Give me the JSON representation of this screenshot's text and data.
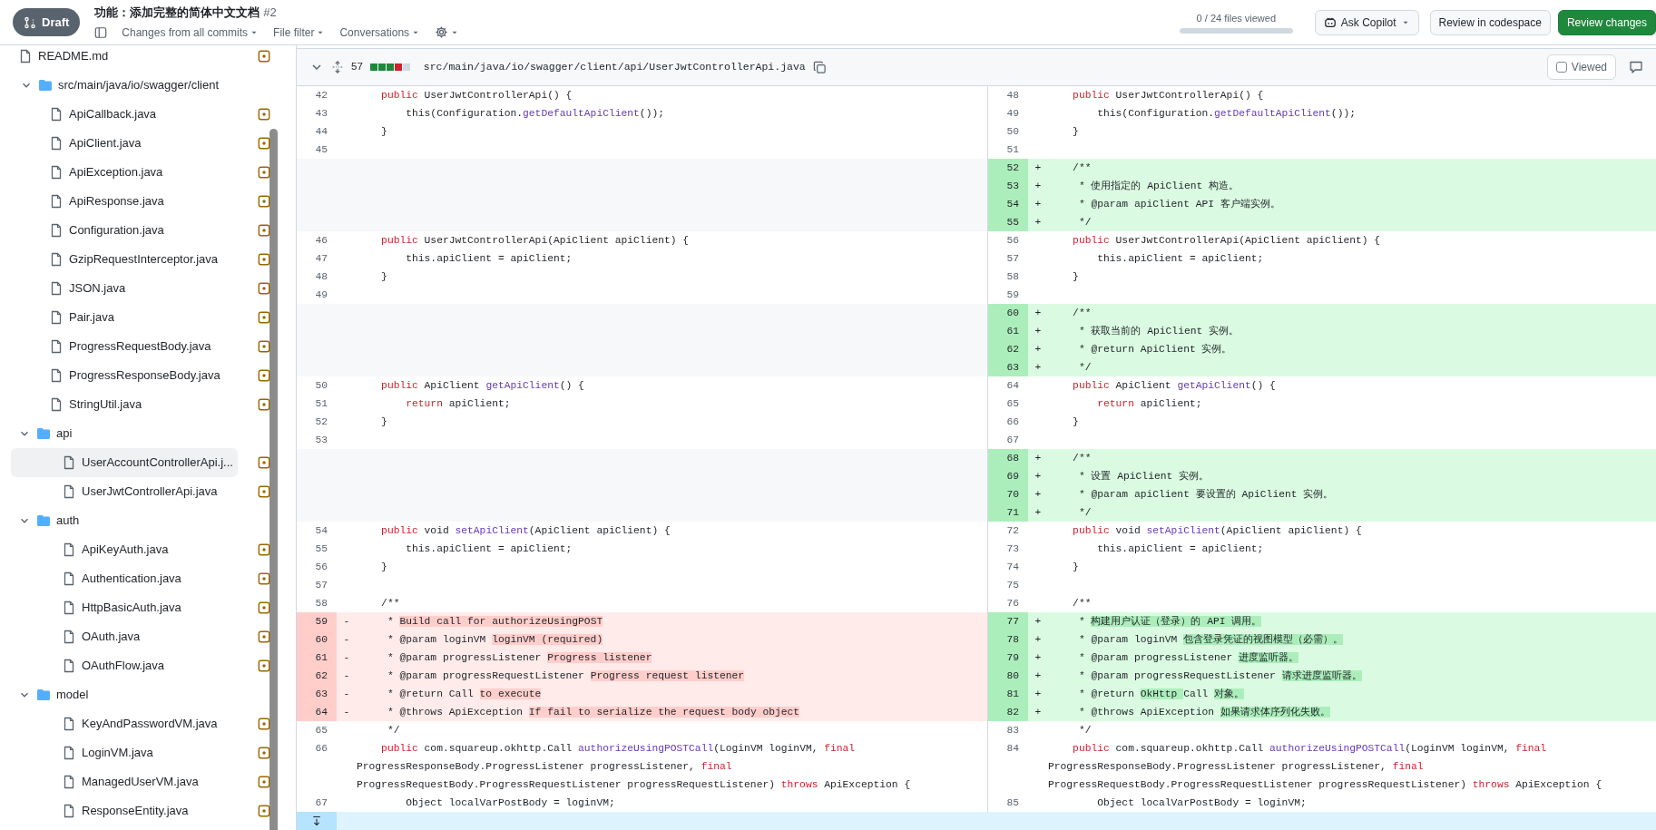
{
  "topbar": {
    "status": "Draft",
    "title": "功能：添加完整的简体中文文档",
    "number": "#2",
    "filters": [
      "Changes from all commits",
      "File filter",
      "Conversations"
    ],
    "viewed_text": "0 / 24 files viewed",
    "viewed_progress": {
      "level": 0
    },
    "buttons": [
      {
        "label": "Ask Copilot",
        "kind": "copilot"
      },
      {
        "label": "Review in codespace",
        "kind": "plain"
      },
      {
        "label": "Review changes",
        "kind": "primary"
      }
    ]
  },
  "tree": {
    "items": [
      {
        "kind": "file",
        "name": "README.md",
        "selected": false
      },
      {
        "kind": "folder",
        "name": "src/main/java/io/swagger/client",
        "expanded": true,
        "selected": false,
        "children": [
          {
            "kind": "file",
            "name": "ApiCallback.java",
            "selected": false
          },
          {
            "kind": "file",
            "name": "ApiClient.java",
            "selected": false
          },
          {
            "kind": "file",
            "name": "ApiException.java",
            "selected": false
          },
          {
            "kind": "file",
            "name": "ApiResponse.java",
            "selected": false
          },
          {
            "kind": "file",
            "name": "Configuration.java",
            "selected": false
          },
          {
            "kind": "file",
            "name": "GzipRequestInterceptor.java",
            "selected": false
          },
          {
            "kind": "file",
            "name": "JSON.java",
            "selected": false
          },
          {
            "kind": "file",
            "name": "Pair.java",
            "selected": false
          },
          {
            "kind": "file",
            "name": "ProgressRequestBody.java",
            "selected": false
          },
          {
            "kind": "file",
            "name": "ProgressResponseBody.java",
            "selected": false
          },
          {
            "kind": "file",
            "name": "StringUtil.java",
            "selected": false
          },
          {
            "kind": "folder",
            "name": "api",
            "expanded": true,
            "selected": false,
            "children": [
              {
                "kind": "file",
                "name": "UserAccountControllerApi.j...",
                "selected": true
              },
              {
                "kind": "file",
                "name": "UserJwtControllerApi.java",
                "selected": false
              }
            ]
          },
          {
            "kind": "folder",
            "name": "auth",
            "expanded": true,
            "selected": false,
            "children": [
              {
                "kind": "file",
                "name": "ApiKeyAuth.java",
                "selected": false
              },
              {
                "kind": "file",
                "name": "Authentication.java",
                "selected": false
              },
              {
                "kind": "file",
                "name": "HttpBasicAuth.java",
                "selected": false
              },
              {
                "kind": "file",
                "name": "OAuth.java",
                "selected": false
              },
              {
                "kind": "file",
                "name": "OAuthFlow.java",
                "selected": false
              }
            ]
          },
          {
            "kind": "folder",
            "name": "model",
            "expanded": true,
            "selected": false,
            "children": [
              {
                "kind": "file",
                "name": "KeyAndPasswordVM.java",
                "selected": false
              },
              {
                "kind": "file",
                "name": "LoginVM.java",
                "selected": false
              },
              {
                "kind": "file",
                "name": "ManagedUserVM.java",
                "selected": false
              },
              {
                "kind": "file",
                "name": "ResponseEntity.java",
                "selected": false
              }
            ]
          }
        ]
      }
    ]
  },
  "file": {
    "expanded": true,
    "changes": "57",
    "diffstat": [
      {
        "kind": "added"
      },
      {
        "kind": "added"
      },
      {
        "kind": "added"
      },
      {
        "kind": "deleted"
      },
      {
        "kind": "neutral"
      }
    ],
    "path": "src/main/java/io/swagger/client/api/UserJwtControllerApi.java",
    "viewed_label": "Viewed",
    "viewed": false
  },
  "rows": [
    {
      "left": {
        "kind": "context",
        "num": "42",
        "lines": [
          [
            {
              "text": "    public",
              "kind": "keyword"
            },
            " UserJwtControllerApi() {"
          ]
        ]
      },
      "right": {
        "kind": "context",
        "num": "48",
        "lines": [
          [
            {
              "text": "    public",
              "kind": "keyword"
            },
            " UserJwtControllerApi() {"
          ]
        ]
      }
    },
    {
      "left": {
        "kind": "context",
        "num": "43",
        "lines": [
          [
            "        this(Configuration.",
            {
              "text": "getDefaultApiClient",
              "kind": "method"
            },
            "());"
          ]
        ]
      },
      "right": {
        "kind": "context",
        "num": "49",
        "lines": [
          [
            "        this(Configuration.",
            {
              "text": "getDefaultApiClient",
              "kind": "method"
            },
            "());"
          ]
        ]
      }
    },
    {
      "left": {
        "kind": "context",
        "num": "44",
        "lines": [
          [
            "    }"
          ]
        ]
      },
      "right": {
        "kind": "context",
        "num": "50",
        "lines": [
          [
            "    }"
          ]
        ]
      }
    },
    {
      "left": {
        "kind": "context",
        "num": "45"
      },
      "right": {
        "kind": "context",
        "num": "51"
      }
    },
    {
      "left": {
        "kind": "empty"
      },
      "right": {
        "kind": "added",
        "num": "52",
        "sign": "+",
        "lines": [
          [
            "    /**"
          ]
        ]
      }
    },
    {
      "left": {
        "kind": "empty"
      },
      "right": {
        "kind": "added",
        "num": "53",
        "sign": "+",
        "lines": [
          [
            "     * 使用指定的 ApiClient 构造。"
          ]
        ]
      }
    },
    {
      "left": {
        "kind": "empty"
      },
      "right": {
        "kind": "added",
        "num": "54",
        "sign": "+",
        "lines": [
          [
            "     * @param apiClient API 客户端实例。"
          ]
        ]
      }
    },
    {
      "left": {
        "kind": "empty"
      },
      "right": {
        "kind": "added",
        "num": "55",
        "sign": "+",
        "lines": [
          [
            "     */"
          ]
        ]
      }
    },
    {
      "left": {
        "kind": "context",
        "num": "46",
        "lines": [
          [
            {
              "text": "    public",
              "kind": "keyword"
            },
            " UserJwtControllerApi(ApiClient apiClient) {"
          ]
        ]
      },
      "right": {
        "kind": "context",
        "num": "56",
        "lines": [
          [
            {
              "text": "    public",
              "kind": "keyword"
            },
            " UserJwtControllerApi(ApiClient apiClient) {"
          ]
        ]
      }
    },
    {
      "left": {
        "kind": "context",
        "num": "47",
        "lines": [
          [
            "        this.apiClient = apiClient;"
          ]
        ]
      },
      "right": {
        "kind": "context",
        "num": "57",
        "lines": [
          [
            "        this.apiClient = apiClient;"
          ]
        ]
      }
    },
    {
      "left": {
        "kind": "context",
        "num": "48",
        "lines": [
          [
            "    }"
          ]
        ]
      },
      "right": {
        "kind": "context",
        "num": "58",
        "lines": [
          [
            "    }"
          ]
        ]
      }
    },
    {
      "left": {
        "kind": "context",
        "num": "49"
      },
      "right": {
        "kind": "context",
        "num": "59"
      }
    },
    {
      "left": {
        "kind": "empty"
      },
      "right": {
        "kind": "added",
        "num": "60",
        "sign": "+",
        "lines": [
          [
            "    /**"
          ]
        ]
      }
    },
    {
      "left": {
        "kind": "empty"
      },
      "right": {
        "kind": "added",
        "num": "61",
        "sign": "+",
        "lines": [
          [
            "     * 获取当前的 ApiClient 实例。"
          ]
        ]
      }
    },
    {
      "left": {
        "kind": "empty"
      },
      "right": {
        "kind": "added",
        "num": "62",
        "sign": "+",
        "lines": [
          [
            "     * @return ApiClient 实例。"
          ]
        ]
      }
    },
    {
      "left": {
        "kind": "empty"
      },
      "right": {
        "kind": "added",
        "num": "63",
        "sign": "+",
        "lines": [
          [
            "     */"
          ]
        ]
      }
    },
    {
      "left": {
        "kind": "context",
        "num": "50",
        "lines": [
          [
            {
              "text": "    public",
              "kind": "keyword"
            },
            " ApiClient ",
            {
              "text": "getApiClient",
              "kind": "method"
            },
            "() {"
          ]
        ]
      },
      "right": {
        "kind": "context",
        "num": "64",
        "lines": [
          [
            {
              "text": "    public",
              "kind": "keyword"
            },
            " ApiClient ",
            {
              "text": "getApiClient",
              "kind": "method"
            },
            "() {"
          ]
        ]
      }
    },
    {
      "left": {
        "kind": "context",
        "num": "51",
        "lines": [
          [
            {
              "text": "        return",
              "kind": "keyword"
            },
            " apiClient;"
          ]
        ]
      },
      "right": {
        "kind": "context",
        "num": "65",
        "lines": [
          [
            {
              "text": "        return",
              "kind": "keyword"
            },
            " apiClient;"
          ]
        ]
      }
    },
    {
      "left": {
        "kind": "context",
        "num": "52",
        "lines": [
          [
            "    }"
          ]
        ]
      },
      "right": {
        "kind": "context",
        "num": "66",
        "lines": [
          [
            "    }"
          ]
        ]
      }
    },
    {
      "left": {
        "kind": "context",
        "num": "53"
      },
      "right": {
        "kind": "context",
        "num": "67"
      }
    },
    {
      "left": {
        "kind": "empty"
      },
      "right": {
        "kind": "added",
        "num": "68",
        "sign": "+",
        "lines": [
          [
            "    /**"
          ]
        ]
      }
    },
    {
      "left": {
        "kind": "empty"
      },
      "right": {
        "kind": "added",
        "num": "69",
        "sign": "+",
        "lines": [
          [
            "     * 设置 ApiClient 实例。"
          ]
        ]
      }
    },
    {
      "left": {
        "kind": "empty"
      },
      "right": {
        "kind": "added",
        "num": "70",
        "sign": "+",
        "lines": [
          [
            "     * @param apiClient 要设置的 ApiClient 实例。"
          ]
        ]
      }
    },
    {
      "left": {
        "kind": "empty"
      },
      "right": {
        "kind": "added",
        "num": "71",
        "sign": "+",
        "lines": [
          [
            "     */"
          ]
        ]
      }
    },
    {
      "left": {
        "kind": "context",
        "num": "54",
        "lines": [
          [
            {
              "text": "    public",
              "kind": "keyword"
            },
            " void ",
            {
              "text": "setApiClient",
              "kind": "method"
            },
            "(ApiClient apiClient) {"
          ]
        ]
      },
      "right": {
        "kind": "context",
        "num": "72",
        "lines": [
          [
            {
              "text": "    public",
              "kind": "keyword"
            },
            " void ",
            {
              "text": "setApiClient",
              "kind": "method"
            },
            "(ApiClient apiClient) {"
          ]
        ]
      }
    },
    {
      "left": {
        "kind": "context",
        "num": "55",
        "lines": [
          [
            "        this.apiClient = apiClient;"
          ]
        ]
      },
      "right": {
        "kind": "context",
        "num": "73",
        "lines": [
          [
            "        this.apiClient = apiClient;"
          ]
        ]
      }
    },
    {
      "left": {
        "kind": "context",
        "num": "56",
        "lines": [
          [
            "    }"
          ]
        ]
      },
      "right": {
        "kind": "context",
        "num": "74",
        "lines": [
          [
            "    }"
          ]
        ]
      }
    },
    {
      "left": {
        "kind": "context",
        "num": "57"
      },
      "right": {
        "kind": "context",
        "num": "75"
      }
    },
    {
      "left": {
        "kind": "context",
        "num": "58",
        "lines": [
          [
            "    /**"
          ]
        ]
      },
      "right": {
        "kind": "context",
        "num": "76",
        "lines": [
          [
            "    /**"
          ]
        ]
      }
    },
    {
      "left": {
        "kind": "deleted",
        "num": "59",
        "sign": "-",
        "lines": [
          [
            "     * ",
            {
              "text": "Build call for authorizeUsingPOST",
              "kind": "changed"
            }
          ]
        ]
      },
      "right": {
        "kind": "added",
        "num": "77",
        "sign": "+",
        "lines": [
          [
            "     * ",
            {
              "text": "构建用户认证（登录）的 API 调用。",
              "kind": "changed"
            }
          ]
        ]
      }
    },
    {
      "left": {
        "kind": "deleted",
        "num": "60",
        "sign": "-",
        "lines": [
          [
            "     * @param loginVM ",
            {
              "text": "loginVM (required)",
              "kind": "changed"
            }
          ]
        ]
      },
      "right": {
        "kind": "added",
        "num": "78",
        "sign": "+",
        "lines": [
          [
            "     * @param loginVM ",
            {
              "text": "包含登录凭证的视图模型（必需）。",
              "kind": "changed"
            }
          ]
        ]
      }
    },
    {
      "left": {
        "kind": "deleted",
        "num": "61",
        "sign": "-",
        "lines": [
          [
            "     * @param progressListener ",
            {
              "text": "Progress listener",
              "kind": "changed"
            }
          ]
        ]
      },
      "right": {
        "kind": "added",
        "num": "79",
        "sign": "+",
        "lines": [
          [
            "     * @param progressListener ",
            {
              "text": "进度监听器。",
              "kind": "changed"
            }
          ]
        ]
      }
    },
    {
      "left": {
        "kind": "deleted",
        "num": "62",
        "sign": "-",
        "lines": [
          [
            "     * @param progressRequestListener ",
            {
              "text": "Progress request listener",
              "kind": "changed"
            }
          ]
        ]
      },
      "right": {
        "kind": "added",
        "num": "80",
        "sign": "+",
        "lines": [
          [
            "     * @param progressRequestListener ",
            {
              "text": "请求进度监听器。",
              "kind": "changed"
            }
          ]
        ]
      }
    },
    {
      "left": {
        "kind": "deleted",
        "num": "63",
        "sign": "-",
        "lines": [
          [
            "     * @return Call ",
            {
              "text": "to execute",
              "kind": "changed"
            }
          ]
        ]
      },
      "right": {
        "kind": "added",
        "num": "81",
        "sign": "+",
        "lines": [
          [
            "     * @return ",
            {
              "text": "OkHttp ",
              "kind": "changed"
            },
            "Call ",
            {
              "text": "对象。",
              "kind": "changed"
            }
          ]
        ]
      }
    },
    {
      "left": {
        "kind": "deleted",
        "num": "64",
        "sign": "-",
        "lines": [
          [
            "     * @throws ApiException ",
            {
              "text": "If fail to serialize the request body object",
              "kind": "changed"
            }
          ]
        ]
      },
      "right": {
        "kind": "added",
        "num": "82",
        "sign": "+",
        "lines": [
          [
            "     * @throws ApiException ",
            {
              "text": "如果请求体序列化失败。",
              "kind": "changed"
            }
          ]
        ]
      }
    },
    {
      "left": {
        "kind": "context",
        "num": "65",
        "lines": [
          [
            "     */"
          ]
        ]
      },
      "right": {
        "kind": "context",
        "num": "83",
        "lines": [
          [
            "     */"
          ]
        ]
      }
    },
    {
      "left": {
        "kind": "context",
        "num": "66",
        "lines": [
          [
            {
              "text": "    public",
              "kind": "keyword"
            },
            " com.squareup.okhttp.Call ",
            {
              "text": "authorizeUsingPOSTCall",
              "kind": "method"
            },
            "(LoginVM loginVM, ",
            {
              "text": "final",
              "kind": "keyword"
            }
          ],
          [
            "ProgressResponseBody.ProgressListener progressListener, ",
            {
              "text": "final",
              "kind": "keyword"
            }
          ],
          [
            "ProgressRequestBody.ProgressRequestListener progressRequestListener) ",
            {
              "text": "throws",
              "kind": "keyword"
            },
            " ApiException {"
          ]
        ]
      },
      "right": {
        "kind": "context",
        "num": "84",
        "lines": [
          [
            {
              "text": "    public",
              "kind": "keyword"
            },
            " com.squareup.okhttp.Call ",
            {
              "text": "authorizeUsingPOSTCall",
              "kind": "method"
            },
            "(LoginVM loginVM, ",
            {
              "text": "final",
              "kind": "keyword"
            }
          ],
          [
            "ProgressResponseBody.ProgressListener progressListener, ",
            {
              "text": "final",
              "kind": "keyword"
            }
          ],
          [
            "ProgressRequestBody.ProgressRequestListener progressRequestListener) ",
            {
              "text": "throws",
              "kind": "keyword"
            },
            " ApiException {"
          ]
        ]
      }
    },
    {
      "left": {
        "kind": "context",
        "num": "67",
        "lines": [
          [
            "        Object localVarPostBody = loginVM;"
          ]
        ]
      },
      "right": {
        "kind": "context",
        "num": "85",
        "lines": [
          [
            "        Object localVarPostBody = loginVM;"
          ]
        ]
      }
    }
  ],
  "hunk": {
    "kind": "expander"
  }
}
